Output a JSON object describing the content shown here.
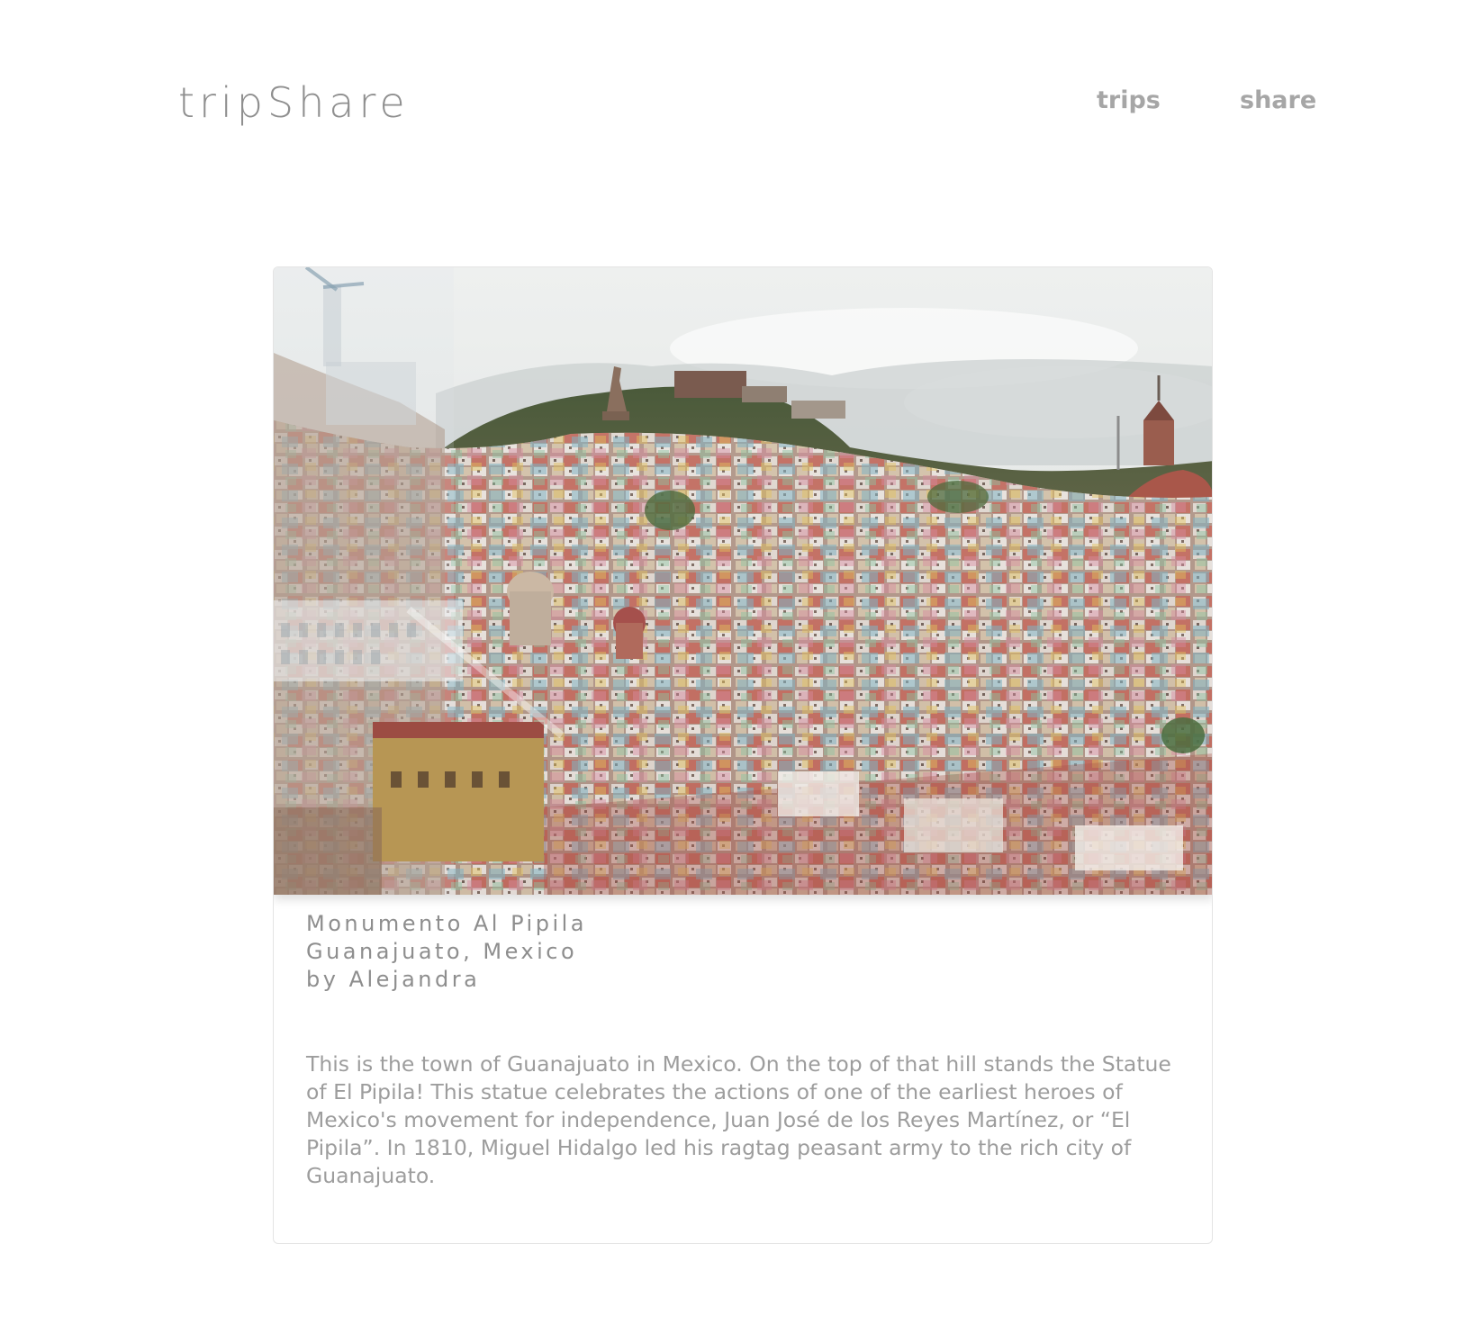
{
  "header": {
    "logo": "tripShare",
    "nav": {
      "trips_label": "trips",
      "share_label": "share"
    }
  },
  "post": {
    "photo_alt": "Monumento Al Pipila, Guanajuato, Mexico",
    "title": "Monumento Al Pipila",
    "location": "Guanajuato, Mexico",
    "author": "by Alejandra",
    "description": "This is the town of Guanajuato in Mexico. On the top of that hill stands the Statue of El Pipila! This statue celebrates the actions of one of the earliest heroes of Mexico's movement for independence, Juan José de los Reyes Martínez, or “El Pipila”. In 1810, Miguel Hidalgo led his ragtag peasant army to the rich city of Guanajuato."
  },
  "colors": {
    "logo": "#8f8f8f",
    "nav": "#a6a6a6",
    "caption": "#8e8e8e",
    "body_text": "#9d9d9d",
    "card_border": "#e4e4e4"
  }
}
